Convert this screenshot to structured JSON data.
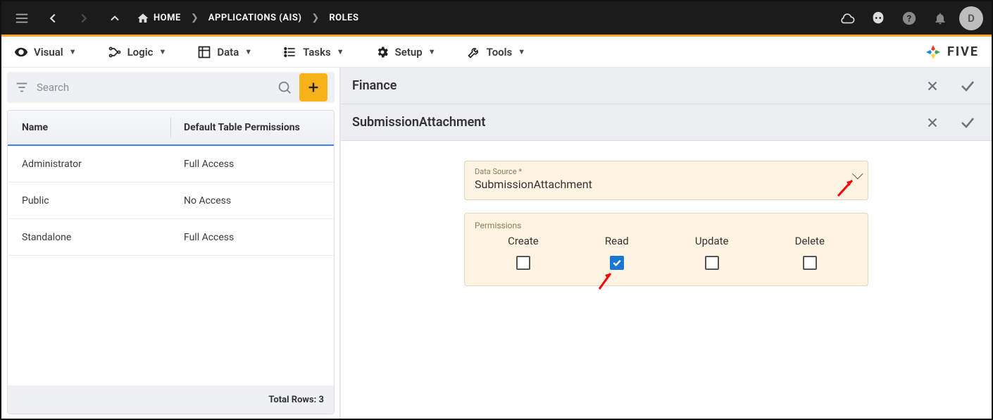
{
  "breadcrumbs": {
    "home": "HOME",
    "applications": "APPLICATIONS (AIS)",
    "roles": "ROLES"
  },
  "user_avatar_initial": "D",
  "toolbar": {
    "visual": "Visual",
    "logic": "Logic",
    "data": "Data",
    "tasks": "Tasks",
    "setup": "Setup",
    "tools": "Tools"
  },
  "brand": "FIVE",
  "search": {
    "placeholder": "Search"
  },
  "table": {
    "headers": {
      "name": "Name",
      "perm": "Default Table Permissions"
    },
    "rows": [
      {
        "name": "Administrator",
        "perm": "Full Access"
      },
      {
        "name": "Public",
        "perm": "No Access"
      },
      {
        "name": "Standalone",
        "perm": "Full Access"
      }
    ],
    "footer_label": "Total Rows: 3"
  },
  "right": {
    "title1": "Finance",
    "title2": "SubmissionAttachment",
    "data_source_label": "Data Source *",
    "data_source_value": "SubmissionAttachment",
    "permissions_label": "Permissions",
    "perms": {
      "create": {
        "label": "Create",
        "checked": false
      },
      "read": {
        "label": "Read",
        "checked": true
      },
      "update": {
        "label": "Update",
        "checked": false
      },
      "delete": {
        "label": "Delete",
        "checked": false
      }
    }
  }
}
